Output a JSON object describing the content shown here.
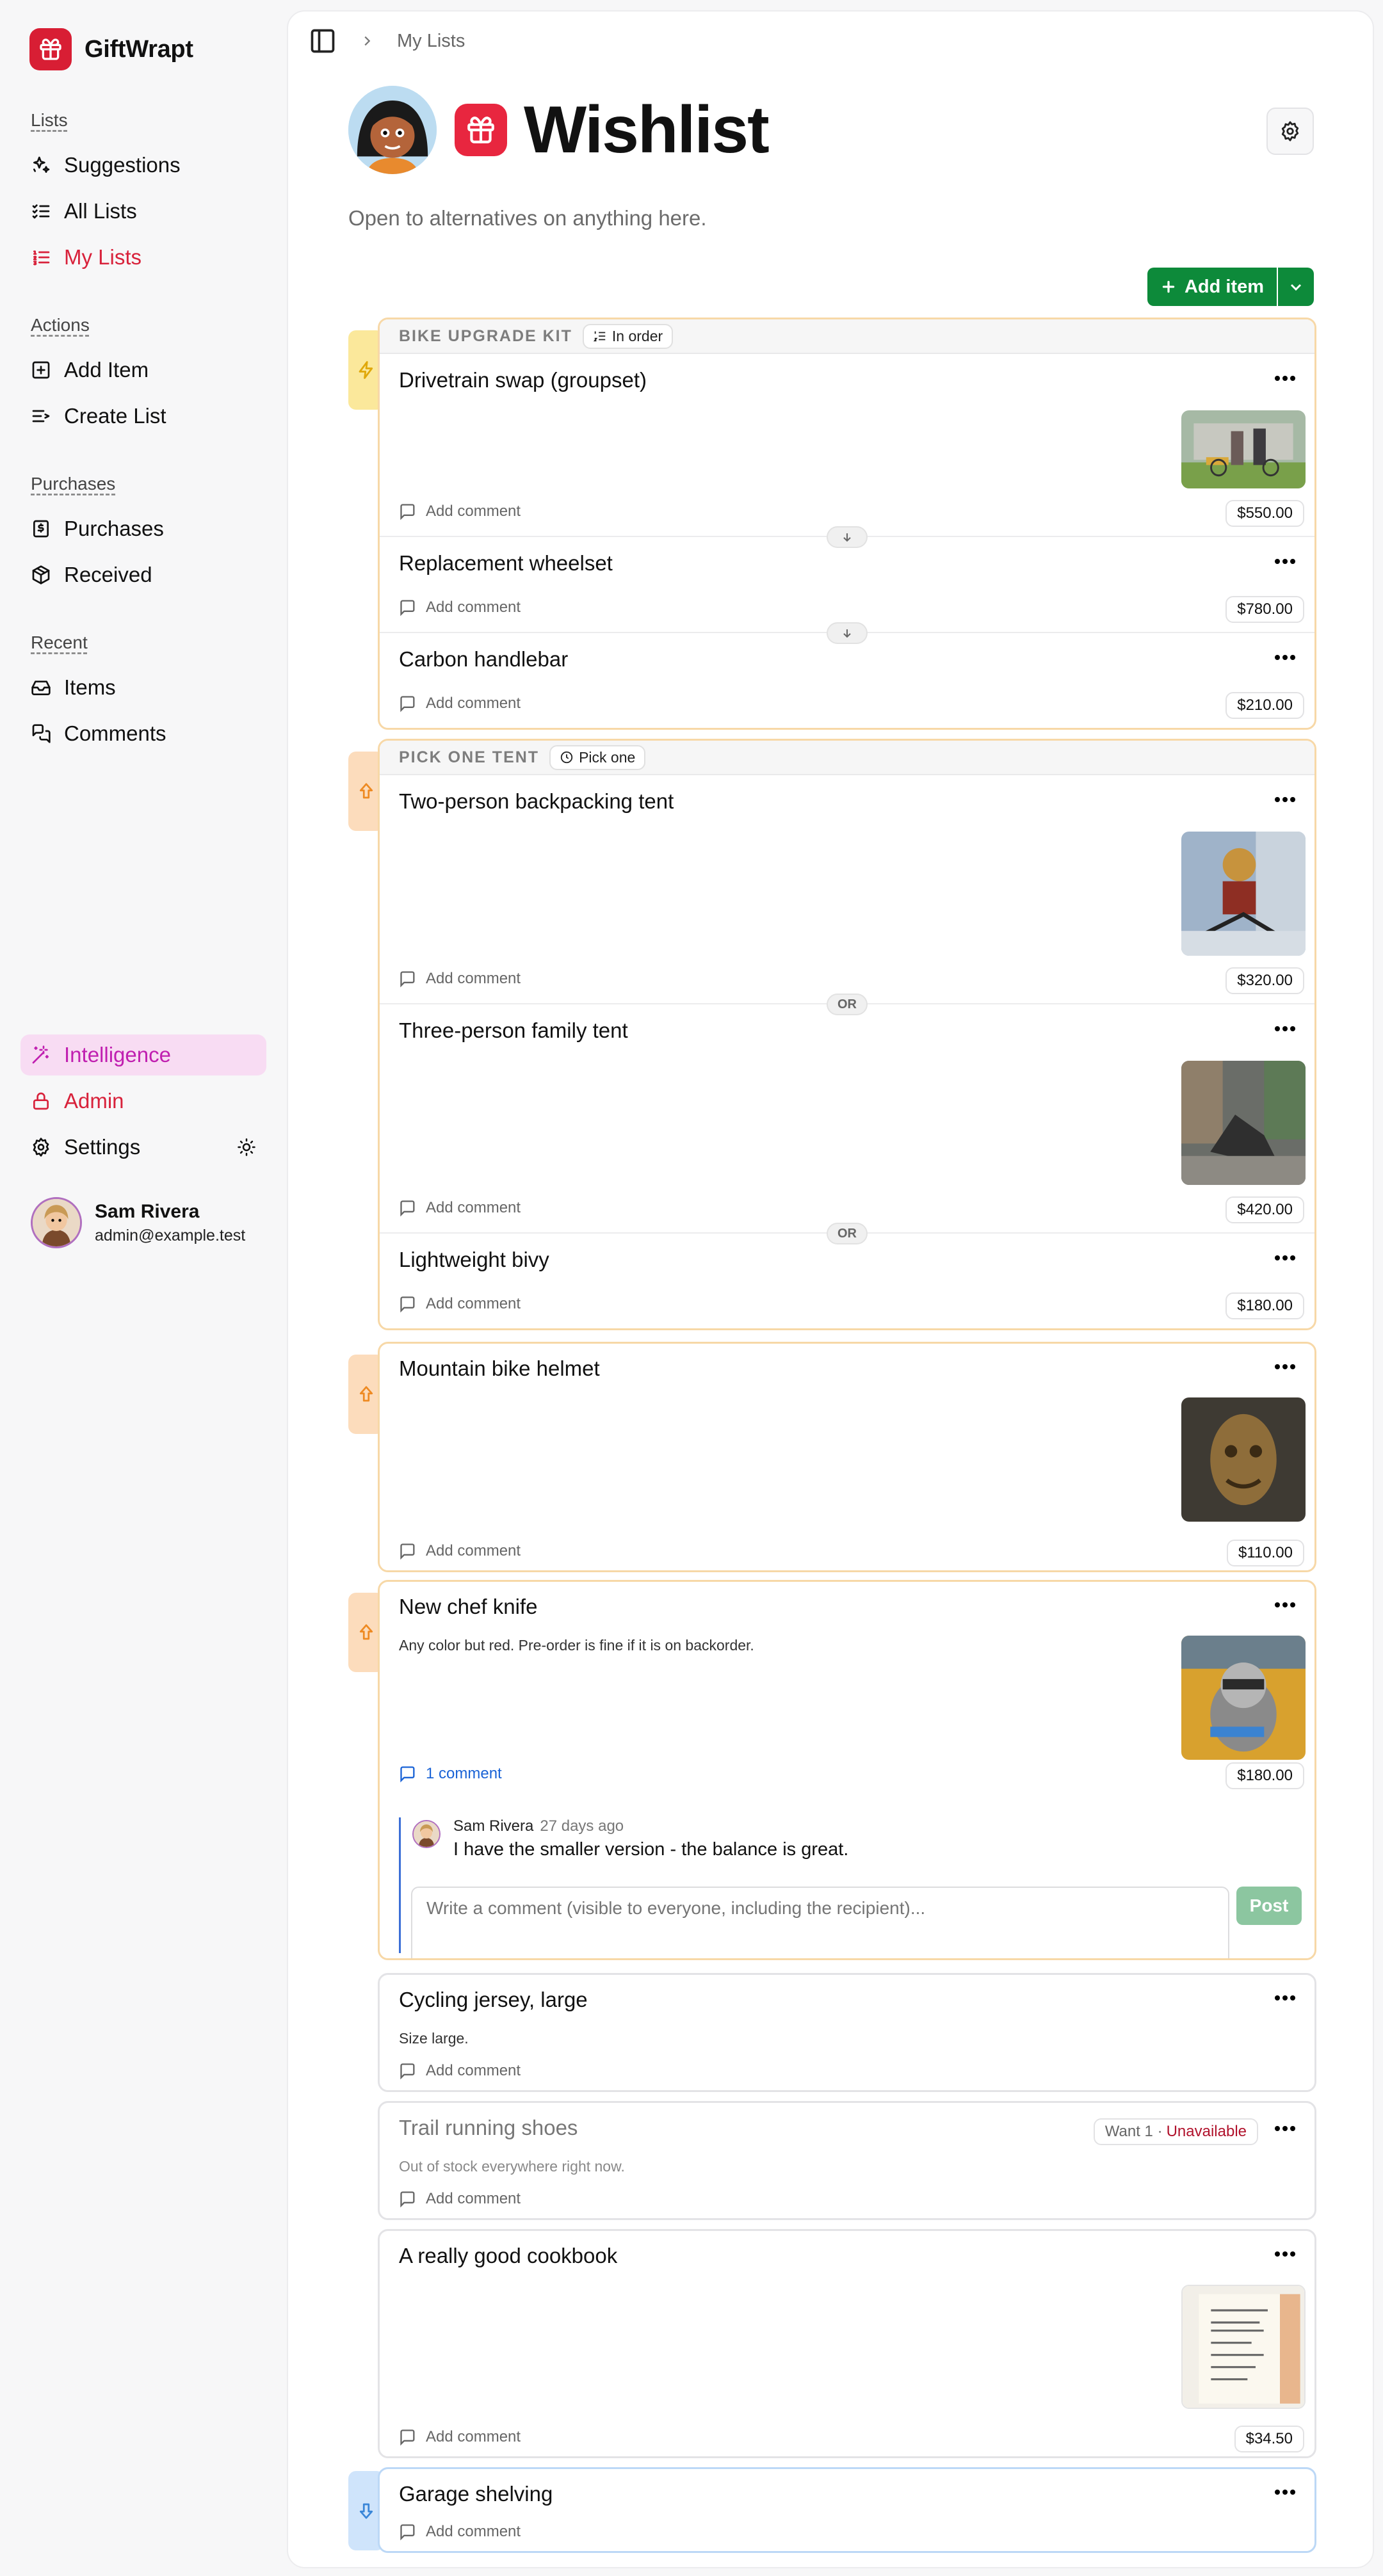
{
  "app": {
    "name": "GiftWrapt"
  },
  "sidebar": {
    "groups": [
      {
        "heading": "Lists",
        "items": [
          {
            "label": "Suggestions",
            "icon": "sparkles-icon"
          },
          {
            "label": "All Lists",
            "icon": "checklist-icon"
          },
          {
            "label": "My Lists",
            "icon": "list-ordered-icon",
            "active": true
          }
        ]
      },
      {
        "heading": "Actions",
        "items": [
          {
            "label": "Add Item",
            "icon": "plus-square-icon"
          },
          {
            "label": "Create List",
            "icon": "list-plus-icon"
          }
        ]
      },
      {
        "heading": "Purchases",
        "items": [
          {
            "label": "Purchases",
            "icon": "receipt-icon"
          },
          {
            "label": "Received",
            "icon": "package-icon"
          }
        ]
      },
      {
        "heading": "Recent",
        "items": [
          {
            "label": "Items",
            "icon": "inbox-icon"
          },
          {
            "label": "Comments",
            "icon": "comments-icon"
          }
        ]
      }
    ],
    "bottom": {
      "intelligence": "Intelligence",
      "admin": "Admin",
      "settings": "Settings"
    },
    "user": {
      "name": "Sam Rivera",
      "email": "admin@example.test"
    }
  },
  "breadcrumb": {
    "current": "My Lists"
  },
  "list": {
    "title": "Wishlist",
    "description": "Open to alternatives on anything here.",
    "add_item_label": "Add item"
  },
  "groups": [
    {
      "label": "BIKE UPGRADE KIT",
      "badge": "In order",
      "priority": "high",
      "items": [
        {
          "title": "Drivetrain swap (groupset)",
          "price": "$550.00",
          "comment": "Add comment",
          "image": "group-ride-photo"
        },
        {
          "title": "Replacement wheelset",
          "price": "$780.00",
          "comment": "Add comment"
        },
        {
          "title": "Carbon handlebar",
          "price": "$210.00",
          "comment": "Add comment"
        }
      ]
    },
    {
      "label": "PICK ONE TENT",
      "badge": "Pick one",
      "connector": "OR",
      "priority": "above-normal",
      "items": [
        {
          "title": "Two-person backpacking tent",
          "price": "$320.00",
          "comment": "Add comment",
          "image": "toy-figure-photo"
        },
        {
          "title": "Three-person family tent",
          "price": "$420.00",
          "comment": "Add comment",
          "image": "street-scene-photo"
        },
        {
          "title": "Lightweight bivy",
          "price": "$180.00",
          "comment": "Add comment"
        }
      ]
    }
  ],
  "items": [
    {
      "title": "Mountain bike helmet",
      "price": "$110.00",
      "comment": "Add comment",
      "priority": "above-normal",
      "image": "carved-statue-photo"
    },
    {
      "title": "New chef knife",
      "note": "Any color but red. Pre-order is fine if it is on backorder.",
      "price": "$180.00",
      "comment": "1 comment",
      "priority": "above-normal",
      "image": "raccoon-photo",
      "thread": {
        "author": "Sam Rivera",
        "ago": "27 days ago",
        "text": "I have the smaller version - the balance is great.",
        "placeholder": "Write a comment (visible to everyone, including the recipient)...",
        "post": "Post"
      }
    },
    {
      "title": "Cycling jersey, large",
      "note": "Size large.",
      "comment": "Add comment"
    },
    {
      "title": "Trail running shoes",
      "note": "Out of stock everywhere right now.",
      "comment": "Add comment",
      "status_want": "Want 1 ·",
      "status_state": "Unavailable"
    },
    {
      "title": "A really good cookbook",
      "price": "$34.50",
      "comment": "Add comment",
      "image": "recipe-page-photo"
    },
    {
      "title": "Garage shelving",
      "comment": "Add comment",
      "priority": "low"
    }
  ],
  "colors": {
    "brand": "#d81e34",
    "accent_green": "#0d8a3a",
    "intelligence": "#c01fb0",
    "high_tab": "#fbe89b",
    "above_tab": "#fcdcbc",
    "low_tab": "#cfe4fb"
  }
}
